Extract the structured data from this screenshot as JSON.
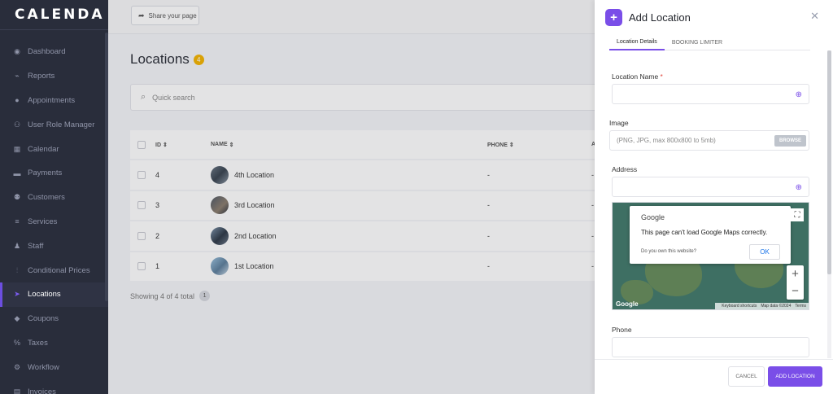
{
  "app": {
    "logo": "CALENDA"
  },
  "sidebar": {
    "items": [
      {
        "label": "Dashboard",
        "icon": "◉"
      },
      {
        "label": "Reports",
        "icon": "⌁"
      },
      {
        "label": "Appointments",
        "icon": "●"
      },
      {
        "label": "User Role Manager",
        "icon": "⚇"
      },
      {
        "label": "Calendar",
        "icon": "▦"
      },
      {
        "label": "Payments",
        "icon": "▬"
      },
      {
        "label": "Customers",
        "icon": "⚉"
      },
      {
        "label": "Services",
        "icon": "≡"
      },
      {
        "label": "Staff",
        "icon": "♟"
      },
      {
        "label": "Conditional Prices",
        "icon": "⫶"
      },
      {
        "label": "Locations",
        "icon": "➤"
      },
      {
        "label": "Coupons",
        "icon": "◆"
      },
      {
        "label": "Taxes",
        "icon": "%"
      },
      {
        "label": "Workflow",
        "icon": "⚙"
      },
      {
        "label": "Invoices",
        "icon": "▤"
      }
    ]
  },
  "topbar": {
    "share_label": "Share your page",
    "share_icon": "➦"
  },
  "page": {
    "title": "Locations",
    "count": "4"
  },
  "search": {
    "placeholder": "Quick search",
    "icon": "⌕"
  },
  "table": {
    "headers": {
      "id": "ID",
      "name": "NAME",
      "phone": "PHONE",
      "extra": "A"
    },
    "sort_icon": "⇕",
    "rows": [
      {
        "id": "4",
        "name": "4th Location",
        "phone": "-",
        "extra": "-"
      },
      {
        "id": "3",
        "name": "3rd Location",
        "phone": "-",
        "extra": "-"
      },
      {
        "id": "2",
        "name": "2nd Location",
        "phone": "-",
        "extra": "-"
      },
      {
        "id": "1",
        "name": "1st Location",
        "phone": "-",
        "extra": "-"
      }
    ],
    "footer": "Showing 4 of 4 total",
    "page": "1"
  },
  "panel": {
    "plus_icon": "+",
    "title": "Add Location",
    "close_icon": "✕",
    "tabs": [
      "Location Details",
      "BOOKING LIMITER"
    ],
    "location_name_label": "Location Name",
    "required_mark": "*",
    "globe_icon": "⊕",
    "image_label": "Image",
    "image_placeholder": "(PNG, JPG, max 800x800 to 5mb)",
    "browse_label": "BROWSE",
    "address_label": "Address",
    "phone_label": "Phone",
    "cancel_label": "CANCEL",
    "add_label": "ADD LOCATION"
  },
  "map": {
    "google_label": "Google",
    "error_message": "This page can't load Google Maps correctly.",
    "own_site": "Do you own this website?",
    "ok_label": "OK",
    "fullscreen_icon": "⛶",
    "zoom_in": "+",
    "zoom_out": "−",
    "footer_shortcuts": "Keyboard shortcuts",
    "footer_data": "Map data ©2024",
    "footer_terms": "Terms",
    "watermark": "Google"
  }
}
